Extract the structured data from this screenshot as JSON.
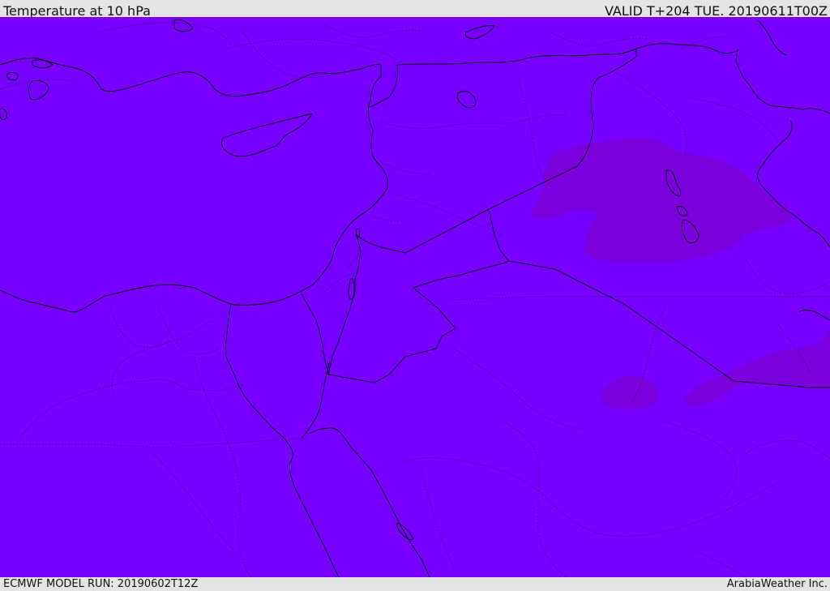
{
  "header": {
    "title": "Temperature at 10 hPa",
    "valid_time": "VALID T+204 TUE. 20190611T00Z"
  },
  "footer": {
    "model_run": "ECMWF MODEL RUN: 20190602T12Z",
    "credit": "ArabiaWeather Inc."
  },
  "map": {
    "field": "temperature",
    "level": "10 hPa",
    "colors": {
      "background_fill": "#7700ff",
      "warm_patch_fill": "#7a00d6",
      "coastline": "#000000",
      "border": "#1a0033"
    }
  }
}
